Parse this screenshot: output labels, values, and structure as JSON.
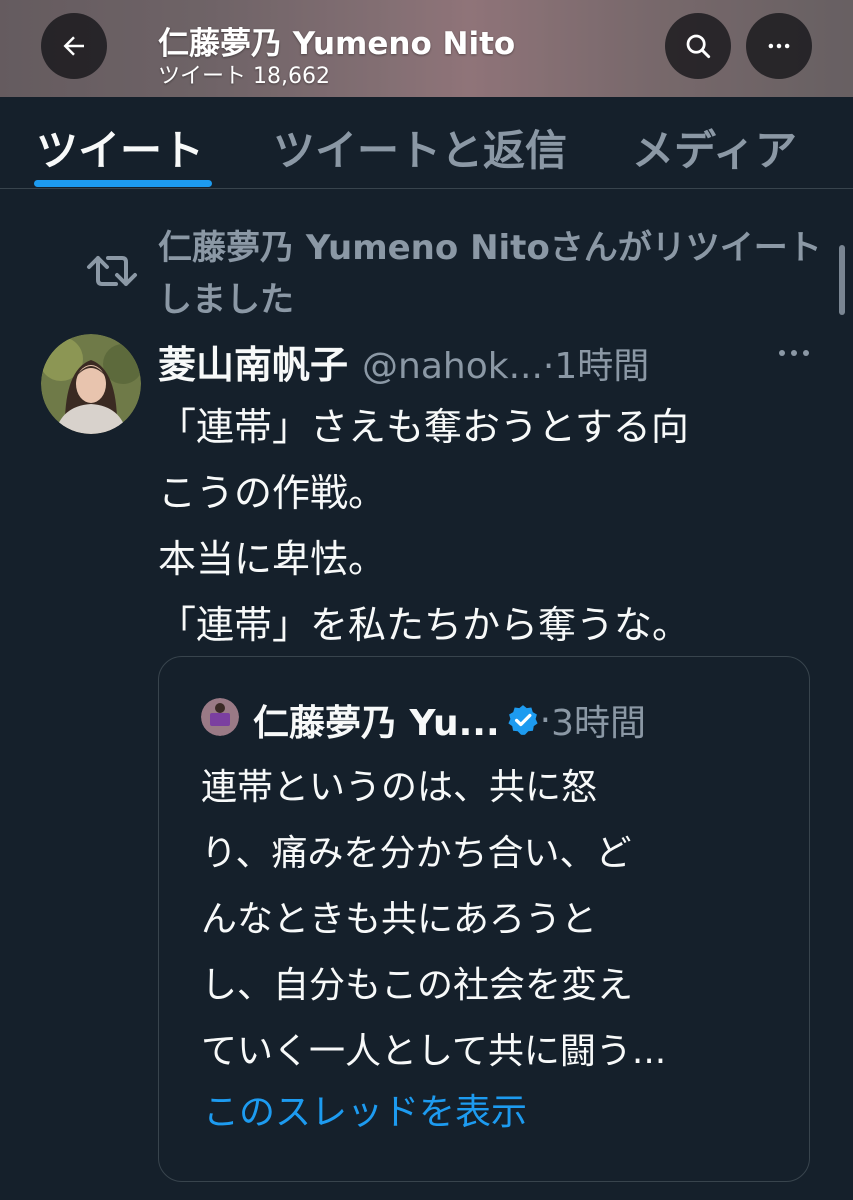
{
  "header": {
    "title": "仁藤夢乃  Yumeno Nito",
    "tweet_count": "ツイート 18,662",
    "icons": [
      "back-arrow-icon",
      "search-icon",
      "more-icon"
    ]
  },
  "tabs": [
    {
      "label": "ツイート",
      "active": true
    },
    {
      "label": "ツイートと返信",
      "active": false
    },
    {
      "label": "メディア",
      "active": false
    }
  ],
  "retweet_context": {
    "text": "仁藤夢乃  Yumeno Nitoさんがリツイートしました",
    "icon": "retweet-icon"
  },
  "tweet": {
    "name": "菱山南帆子",
    "handle": "@nahok...",
    "separator": "·",
    "time": "1時間",
    "lines": [
      "「連帯」さえも奪おうとする向",
      "こうの作戦。",
      "本当に卑怯。",
      "「連帯」を私たちから奪うな。"
    ]
  },
  "quoted_tweet": {
    "name": "仁藤夢乃  Yu...",
    "separator": "·",
    "time": "3時間",
    "lines": [
      "連帯というのは、共に怒",
      "り、痛みを分かち合い、ど",
      "んなときも共にあろうと",
      "し、自分もこの社会を変え",
      "ていく一人として共に闘う..."
    ],
    "show_thread": "このスレッドを表示"
  },
  "colors": {
    "background": "#15202b",
    "text": "#f7f9f9",
    "secondary": "#8b98a5",
    "accent": "#1d9bf0",
    "border": "#38444d"
  }
}
